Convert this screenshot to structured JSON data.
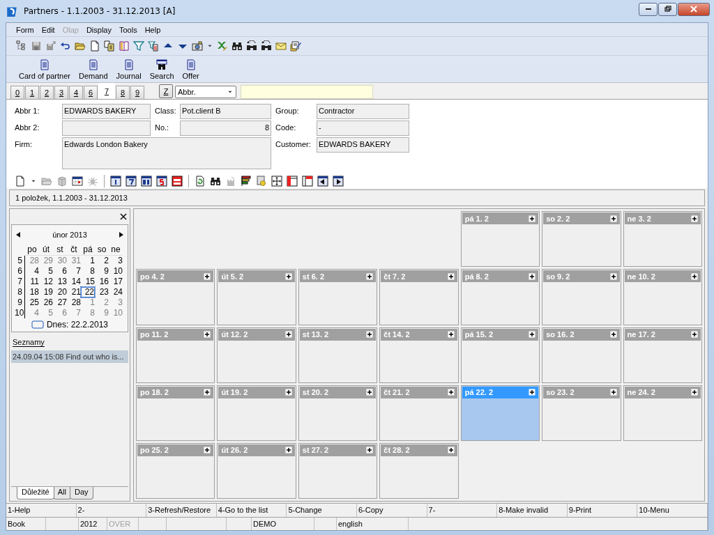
{
  "window": {
    "title": "Partners - 1.1.2003 - 31.12.2013 [A]"
  },
  "menu": [
    {
      "label": "Form",
      "disabled": false
    },
    {
      "label": "Edit",
      "disabled": false
    },
    {
      "label": "Olap",
      "disabled": true
    },
    {
      "label": "Display",
      "disabled": false
    },
    {
      "label": "Tools",
      "disabled": false
    },
    {
      "label": "Help",
      "disabled": false
    }
  ],
  "big_toolbar": [
    {
      "label": "Card of partner",
      "kind": "document"
    },
    {
      "label": "Demand",
      "kind": "document"
    },
    {
      "label": "Journal",
      "kind": "document"
    },
    {
      "label": "Search",
      "kind": "search"
    },
    {
      "label": "Offer",
      "kind": "document"
    }
  ],
  "tabs": [
    {
      "label": "0",
      "selected": false
    },
    {
      "label": "1",
      "selected": false
    },
    {
      "label": "2",
      "selected": false
    },
    {
      "label": "3",
      "selected": false
    },
    {
      "label": "4",
      "selected": false
    },
    {
      "label": "6",
      "selected": false
    },
    {
      "label": "7",
      "selected": true
    },
    {
      "label": "8",
      "selected": false
    },
    {
      "label": "9",
      "selected": false
    }
  ],
  "sort_button": "Z",
  "sort_field": {
    "value": "Abbr."
  },
  "form": {
    "columns": [
      [
        {
          "label": "Abbr 1:",
          "value": "EDWARDS BAKERY",
          "kind": "text"
        },
        {
          "label": "Abbr 2:",
          "kind": "text"
        },
        {
          "label": "Firm:",
          "value": "Edwards London Bakery",
          "kind": "memo"
        }
      ],
      [
        {
          "label": "Class:",
          "value": "Pot.client B",
          "kind": "text"
        },
        {
          "label": "No.:",
          "value": "8",
          "kind": "number"
        }
      ],
      [
        {
          "label": "Group:",
          "value": "Contractor",
          "kind": "text"
        },
        {
          "label": "Code:",
          "value": "-",
          "kind": "text"
        },
        {
          "label": "Customer:",
          "value": "EDWARDS BAKERY",
          "kind": "text"
        }
      ]
    ]
  },
  "list_info": "1 položek, 1.1.2003 - 31.12.2013",
  "mini_calendar": {
    "month": "únor 2013",
    "weekdays": [
      "po",
      "út",
      "st",
      "čt",
      "pá",
      "so",
      "ne"
    ],
    "weeks": [
      {
        "week": "5",
        "days": [
          {
            "day": "28",
            "other_month": true,
            "selected": false
          },
          {
            "day": "29",
            "other_month": true,
            "selected": false
          },
          {
            "day": "30",
            "other_month": true,
            "selected": false
          },
          {
            "day": "31",
            "other_month": true,
            "selected": false
          },
          {
            "day": "1",
            "other_month": false,
            "selected": false
          },
          {
            "day": "2",
            "other_month": false,
            "selected": false
          },
          {
            "day": "3",
            "other_month": false,
            "selected": false
          }
        ]
      },
      {
        "week": "6",
        "days": [
          {
            "day": "4",
            "other_month": false,
            "selected": false
          },
          {
            "day": "5",
            "other_month": false,
            "selected": false
          },
          {
            "day": "6",
            "other_month": false,
            "selected": false
          },
          {
            "day": "7",
            "other_month": false,
            "selected": false
          },
          {
            "day": "8",
            "other_month": false,
            "selected": false
          },
          {
            "day": "9",
            "other_month": false,
            "selected": false
          },
          {
            "day": "10",
            "other_month": false,
            "selected": false
          }
        ]
      },
      {
        "week": "7",
        "days": [
          {
            "day": "11",
            "other_month": false,
            "selected": false
          },
          {
            "day": "12",
            "other_month": false,
            "selected": false
          },
          {
            "day": "13",
            "other_month": false,
            "selected": false
          },
          {
            "day": "14",
            "other_month": false,
            "selected": false
          },
          {
            "day": "15",
            "other_month": false,
            "selected": false
          },
          {
            "day": "16",
            "other_month": false,
            "selected": false
          },
          {
            "day": "17",
            "other_month": false,
            "selected": false
          }
        ]
      },
      {
        "week": "8",
        "days": [
          {
            "day": "18",
            "other_month": false,
            "selected": false
          },
          {
            "day": "19",
            "other_month": false,
            "selected": false
          },
          {
            "day": "20",
            "other_month": false,
            "selected": false
          },
          {
            "day": "21",
            "other_month": false,
            "selected": false
          },
          {
            "day": "22",
            "other_month": false,
            "selected": true
          },
          {
            "day": "23",
            "other_month": false,
            "selected": false
          },
          {
            "day": "24",
            "other_month": false,
            "selected": false
          }
        ]
      },
      {
        "week": "9",
        "days": [
          {
            "day": "25",
            "other_month": false,
            "selected": false
          },
          {
            "day": "26",
            "other_month": false,
            "selected": false
          },
          {
            "day": "27",
            "other_month": false,
            "selected": false
          },
          {
            "day": "28",
            "other_month": false,
            "selected": false
          },
          {
            "day": "1",
            "other_month": true,
            "selected": false
          },
          {
            "day": "2",
            "other_month": true,
            "selected": false
          },
          {
            "day": "3",
            "other_month": true,
            "selected": false
          }
        ]
      },
      {
        "week": "10",
        "days": [
          {
            "day": "4",
            "other_month": true,
            "selected": false
          },
          {
            "day": "5",
            "other_month": true,
            "selected": false
          },
          {
            "day": "6",
            "other_month": true,
            "selected": false
          },
          {
            "day": "7",
            "other_month": true,
            "selected": false
          },
          {
            "day": "8",
            "other_month": true,
            "selected": false
          },
          {
            "day": "9",
            "other_month": true,
            "selected": false
          },
          {
            "day": "10",
            "other_month": true,
            "selected": false
          }
        ]
      }
    ],
    "today": "Dnes: 22.2.2013"
  },
  "list_title": "Seznamy",
  "list_items": [
    {
      "text": "24.09.04 15:08 Find out who is...",
      "selected": true
    }
  ],
  "bottom_tabs": [
    {
      "label": "Důležité",
      "selected": true
    },
    {
      "label": "All",
      "selected": false
    },
    {
      "label": "Day",
      "selected": false
    }
  ],
  "calendar": {
    "weeks": [
      [
        {
          "kind": "empty"
        },
        {
          "kind": "empty"
        },
        {
          "kind": "empty"
        },
        {
          "kind": "empty"
        },
        {
          "kind": "day",
          "label": "pá 1. 2",
          "selected": false
        },
        {
          "kind": "day",
          "label": "so 2. 2",
          "selected": false
        },
        {
          "kind": "day",
          "label": "ne 3. 2",
          "selected": false
        }
      ],
      [
        {
          "kind": "day",
          "label": "po 4. 2",
          "selected": false
        },
        {
          "kind": "day",
          "label": "út 5. 2",
          "selected": false
        },
        {
          "kind": "day",
          "label": "st 6. 2",
          "selected": false
        },
        {
          "kind": "day",
          "label": "čt 7. 2",
          "selected": false
        },
        {
          "kind": "day",
          "label": "pá 8. 2",
          "selected": false
        },
        {
          "kind": "day",
          "label": "so 9. 2",
          "selected": false
        },
        {
          "kind": "day",
          "label": "ne 10. 2",
          "selected": false
        }
      ],
      [
        {
          "kind": "day",
          "label": "po 11. 2",
          "selected": false
        },
        {
          "kind": "day",
          "label": "út 12. 2",
          "selected": false
        },
        {
          "kind": "day",
          "label": "st 13. 2",
          "selected": false
        },
        {
          "kind": "day",
          "label": "čt 14. 2",
          "selected": false
        },
        {
          "kind": "day",
          "label": "pá 15. 2",
          "selected": false
        },
        {
          "kind": "day",
          "label": "so 16. 2",
          "selected": false
        },
        {
          "kind": "day",
          "label": "ne 17. 2",
          "selected": false
        }
      ],
      [
        {
          "kind": "day",
          "label": "po 18. 2",
          "selected": false
        },
        {
          "kind": "day",
          "label": "út 19. 2",
          "selected": false
        },
        {
          "kind": "day",
          "label": "st 20. 2",
          "selected": false
        },
        {
          "kind": "day",
          "label": "čt 21. 2",
          "selected": false
        },
        {
          "kind": "day",
          "label": "pá 22. 2",
          "selected": true
        },
        {
          "kind": "day",
          "label": "so 23. 2",
          "selected": false
        },
        {
          "kind": "day",
          "label": "ne 24. 2",
          "selected": false
        }
      ],
      [
        {
          "kind": "day",
          "label": "po 25. 2",
          "selected": false
        },
        {
          "kind": "day",
          "label": "út 26. 2",
          "selected": false
        },
        {
          "kind": "day",
          "label": "st 27. 2",
          "selected": false
        },
        {
          "kind": "day",
          "label": "čt 28. 2",
          "selected": false
        },
        {
          "kind": "empty"
        },
        {
          "kind": "empty"
        },
        {
          "kind": "empty"
        }
      ]
    ]
  },
  "function_keys": [
    "1-Help",
    "2-",
    "3-Refresh/Restore",
    "4-Go to the list",
    "5-Change",
    "6-Copy",
    "7-",
    "8-Make invalid",
    "9-Print",
    "10-Menu"
  ],
  "status_bar": [
    {
      "text": "Book",
      "disabled": false
    },
    {
      "text": "2012",
      "disabled": false
    },
    {
      "text": "OVER",
      "disabled": true
    },
    {
      "text": "DEMO",
      "disabled": false
    },
    {
      "text": "english",
      "disabled": false
    }
  ]
}
